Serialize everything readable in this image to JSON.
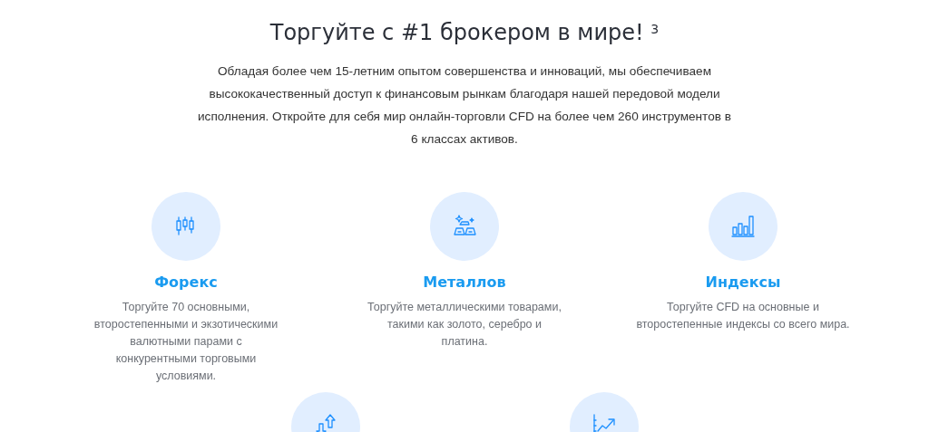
{
  "heading": "Торгуйте с #1 брокером в мире! $^{3}$",
  "intro": "Обладая более чем 15-летним опытом совершенства и инноваций, мы обеспечиваем высококачественный доступ к финансовым рынкам благодаря нашей передовой модели исполнения. Откройте для себя мир онлайн-торговли CFD на более чем 260 инструментов в 6 классах активов.",
  "features": [
    {
      "kind": "candles",
      "title": "Форекс",
      "text": "Торгуйте 70 основными, второстепенными и экзотическими валютными парами с конкурентными торговыми условиями."
    },
    {
      "kind": "bars",
      "title": "Металлов",
      "text": "Торгуйте металлическими товарами, такими как золото, серебро и платина."
    },
    {
      "kind": "chart",
      "title": "Индексы",
      "text": "Торгуйте CFD на основные и второстепенные индексы со всего мира."
    },
    {
      "kind": "arrows"
    },
    {
      "kind": "growth"
    }
  ]
}
